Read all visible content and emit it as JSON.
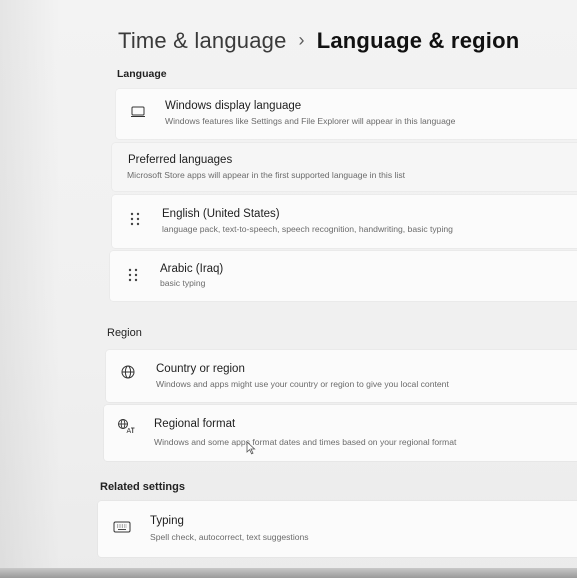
{
  "breadcrumb": {
    "parent": "Time & language",
    "separator": "›",
    "current": "Language & region"
  },
  "language_section": {
    "label": "Language",
    "display_language": {
      "title": "Windows display language",
      "description": "Windows features like Settings and File Explorer will appear in this language",
      "icon": "monitor-icon"
    },
    "preferred_languages": {
      "title": "Preferred languages",
      "description": "Microsoft Store apps will appear in the first supported language in this list"
    },
    "languages": [
      {
        "title": "English (United States)",
        "description": "language pack, text-to-speech, speech recognition, handwriting, basic typing",
        "icon": "drag-handle-icon"
      },
      {
        "title": "Arabic (Iraq)",
        "description": "basic typing",
        "icon": "drag-handle-icon"
      }
    ]
  },
  "region_section": {
    "label": "Region",
    "country": {
      "title": "Country or region",
      "description": "Windows and apps might use your country or region to give you local content",
      "icon": "globe-icon"
    },
    "regional_format": {
      "title": "Regional format",
      "description": "Windows and some apps format dates and times based on your regional format",
      "icon": "language-format-icon"
    }
  },
  "related_section": {
    "label": "Related settings",
    "typing": {
      "title": "Typing",
      "description": "Spell check, autocorrect, text suggestions",
      "icon": "keyboard-icon"
    }
  },
  "colors": {
    "background": "#f3f3f3",
    "card": "#fbfbfb",
    "text_primary": "#1e1e1e",
    "text_secondary": "#6b6b6b"
  }
}
